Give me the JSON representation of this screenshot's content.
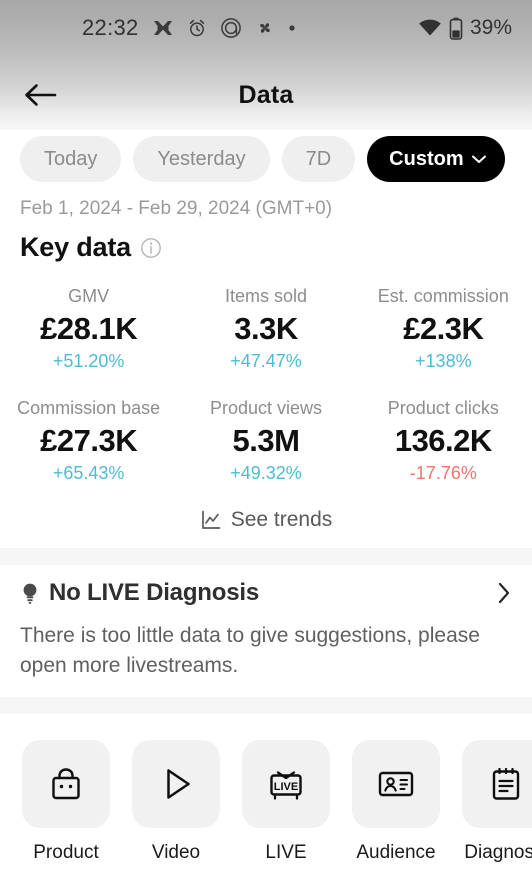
{
  "status_bar": {
    "time": "22:32",
    "battery_text": "39%",
    "icons": [
      "halifax-logo-icon",
      "alarm-clock-icon",
      "monzo-logo-icon",
      "pinwheel-icon",
      "dot-icon"
    ],
    "right_icons": [
      "wifi-icon",
      "battery-icon"
    ]
  },
  "header": {
    "title": "Data",
    "back_icon": "back-arrow-icon"
  },
  "filters": {
    "chips": [
      {
        "label": "Today",
        "active": false
      },
      {
        "label": "Yesterday",
        "active": false
      },
      {
        "label": "7D",
        "active": false
      },
      {
        "label": "Custom",
        "active": true
      }
    ]
  },
  "date_range": "Feb 1, 2024 - Feb 29, 2024 (GMT+0)",
  "key_data": {
    "title": "Key data",
    "info_icon": "info-circle-icon",
    "metrics": [
      {
        "label": "GMV",
        "value": "£28.1K",
        "delta": "+51.20%",
        "direction": "up"
      },
      {
        "label": "Items sold",
        "value": "3.3K",
        "delta": "+47.47%",
        "direction": "up"
      },
      {
        "label": "Est. commission",
        "value": "£2.3K",
        "delta": "+138%",
        "direction": "up"
      },
      {
        "label": "Commission base",
        "value": "£27.3K",
        "delta": "+65.43%",
        "direction": "up"
      },
      {
        "label": "Product views",
        "value": "5.3M",
        "delta": "+49.32%",
        "direction": "up"
      },
      {
        "label": "Product clicks",
        "value": "136.2K",
        "delta": "-17.76%",
        "direction": "down"
      }
    ],
    "see_trends_label": "See trends",
    "see_trends_icon": "trend-chart-icon"
  },
  "diagnosis": {
    "icon": "lightbulb-icon",
    "title": "No LIVE Diagnosis",
    "body": "There is too little data to give suggestions, please open more livestreams.",
    "chevron_icon": "chevron-right-icon"
  },
  "shortcuts": [
    {
      "label": "Product",
      "icon": "shopping-bag-icon"
    },
    {
      "label": "Video",
      "icon": "play-triangle-icon"
    },
    {
      "label": "LIVE",
      "icon": "live-tv-icon"
    },
    {
      "label": "Audience",
      "icon": "id-card-icon"
    },
    {
      "label": "Diagnosis",
      "icon": "clipboard-icon"
    }
  ],
  "colors": {
    "positive": "#4cbcd6",
    "negative": "#f4736b",
    "accent_active_chip": "#000000",
    "chip_bg": "#efefef",
    "tile_bg": "#f1f1f1"
  }
}
